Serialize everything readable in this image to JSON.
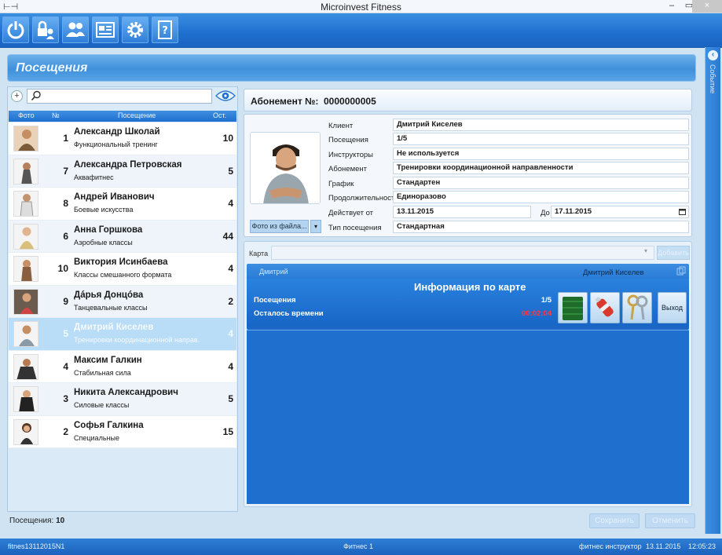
{
  "window": {
    "title": "Microinvest Fitness",
    "minimize": "–",
    "restore": "▭",
    "close": "×"
  },
  "toolbar": {
    "icons": [
      "power-icon",
      "lock-user-icon",
      "users-icon",
      "card-icon",
      "gear-icon",
      "help-book-icon"
    ]
  },
  "header": {
    "title": "Посещения"
  },
  "side_strip": {
    "label": "Событие"
  },
  "visits_list": {
    "add_symbol": "+",
    "search_value": "",
    "columns": [
      "Фото",
      "№",
      "Посещение",
      "Ост."
    ],
    "rows": [
      {
        "num": "1",
        "name": "Александр Школай",
        "class": "Функциональный тренинг",
        "remaining": "10",
        "selected": false
      },
      {
        "num": "7",
        "name": "Александра Петровская",
        "class": "Аквафитнес",
        "remaining": "5",
        "selected": false
      },
      {
        "num": "8",
        "name": "Андрей Иванович",
        "class": "Боевые искусства",
        "remaining": "4",
        "selected": false
      },
      {
        "num": "6",
        "name": "Анна Горшкова",
        "class": "Аэробные классы",
        "remaining": "44",
        "selected": false
      },
      {
        "num": "10",
        "name": "Виктория Исинбаева",
        "class": "Классы смешанного формата",
        "remaining": "4",
        "selected": false
      },
      {
        "num": "9",
        "name": "Дáрья Донцóва",
        "class": "Танцевальные классы",
        "remaining": "2",
        "selected": false
      },
      {
        "num": "5",
        "name": "Дмитрий Киселев",
        "class": "Тренировки координационной направ.",
        "remaining": "4",
        "selected": true
      },
      {
        "num": "4",
        "name": "Максим Галкин",
        "class": "Стабильная сила",
        "remaining": "4",
        "selected": false
      },
      {
        "num": "3",
        "name": "Никита Александрович",
        "class": "Силовые классы",
        "remaining": "5",
        "selected": false
      },
      {
        "num": "2",
        "name": "Софья Галкина",
        "class": "Специальные",
        "remaining": "15",
        "selected": false
      }
    ],
    "footer_label": "Посещения:",
    "footer_count": "10"
  },
  "bottom_buttons": {
    "save": "Сохранить",
    "cancel": "Отменить"
  },
  "abonement": {
    "label": "Абонемент №:",
    "number": "0000000005"
  },
  "details": {
    "photo_button": "Фото из файла...",
    "photo_dropdown": "▾",
    "client_label": "Клиент",
    "client": "Дмитрий Киселев",
    "visits_label": "Посещения",
    "visits": "1/5",
    "instructors_label": "Инструкторы",
    "instructors": "Не используется",
    "abonement_label": "Абонемент",
    "abonement": "Тренировки координационной направленности",
    "schedule_label": "График",
    "schedule": "Стандартен",
    "duration_label": "Продолжительность",
    "duration": "Единоразово",
    "valid_from_label": "Действует от",
    "valid_from": "13.11.2015",
    "valid_to_label": "До",
    "valid_to": "17.11.2015",
    "visit_type_label": "Тип посещения",
    "visit_type": "Стандартная"
  },
  "card": {
    "label": "Карта",
    "value": "",
    "add_button": "Добавить",
    "nick": "Дмитрий",
    "owner": "Дмитрий Киселев",
    "info_title": "Информация по карте",
    "visits_label": "Посещения",
    "visits": "1/5",
    "time_left_label": "Осталось времени",
    "time_left": "00:02:04",
    "exit_button": "Выход"
  },
  "statusbar": {
    "db": "fitnes13112015N1",
    "location": "Фитнес 1",
    "user": "фитнес инструктор",
    "date": "13.11.2015",
    "time": "12:05:23"
  },
  "colors": {
    "accent": "#1f6fcf",
    "selected_row": "#b9dcf7",
    "time_left": "#ff3b3b"
  }
}
